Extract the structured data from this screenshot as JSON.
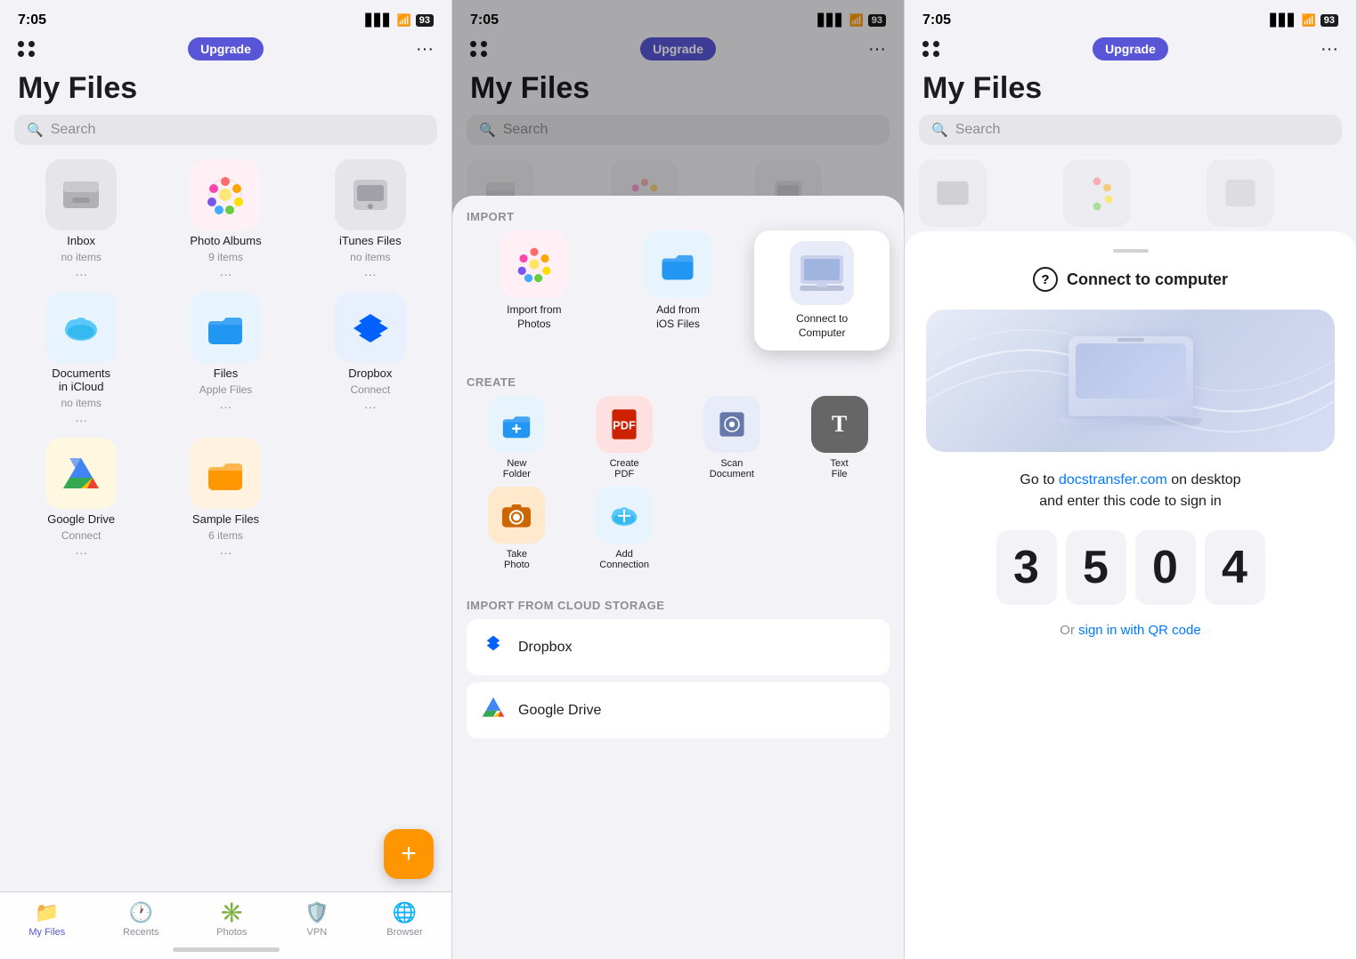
{
  "panel1": {
    "status_time": "7:05",
    "battery": "93",
    "title": "My Files",
    "search_placeholder": "Search",
    "upgrade_label": "Upgrade",
    "files": [
      {
        "name": "Inbox",
        "sub": "no items",
        "emoji": "📥",
        "bg": "#e5e5ea"
      },
      {
        "name": "Photo Albums",
        "sub": "9 items",
        "emoji": "🌸",
        "bg": "#fff0f5"
      },
      {
        "name": "iTunes Files",
        "sub": "no items",
        "emoji": "💾",
        "bg": "#e5e5ea"
      },
      {
        "name": "Documents in iCloud",
        "sub": "no items",
        "emoji": "☁️",
        "bg": "#e8f4fd"
      },
      {
        "name": "Files",
        "sub": "Apple Files",
        "emoji": "📁",
        "bg": "#e8f4fd"
      },
      {
        "name": "Dropbox",
        "sub": "Connect",
        "emoji": "📦",
        "bg": "#e8f0fe"
      },
      {
        "name": "Google Drive",
        "sub": "Connect",
        "emoji": "🔺",
        "bg": "#fff8e1"
      },
      {
        "name": "Sample Files",
        "sub": "6 items",
        "emoji": "📂",
        "bg": "#fff3e0"
      }
    ],
    "nav": [
      {
        "label": "My Files",
        "icon": "📁",
        "active": true
      },
      {
        "label": "Recents",
        "icon": "🕐",
        "active": false
      },
      {
        "label": "Photos",
        "icon": "✳️",
        "active": false
      },
      {
        "label": "VPN",
        "icon": "🛡️",
        "active": false
      },
      {
        "label": "Browser",
        "icon": "🌐",
        "active": false
      }
    ]
  },
  "panel2": {
    "status_time": "7:05",
    "battery": "93",
    "title": "My Files",
    "search_placeholder": "Search",
    "upgrade_label": "Upgrade",
    "import_label": "IMPORT",
    "create_label": "CREATE",
    "cloud_label": "IMPORT FROM CLOUD STORAGE",
    "import_actions": [
      {
        "name": "Import from Photos",
        "emoji": "🌸",
        "bg": "#fff0f5"
      },
      {
        "name": "Add from iOS Files",
        "emoji": "📁",
        "bg": "#e8f4fd"
      }
    ],
    "connect_action": {
      "name": "Connect to Computer",
      "emoji": "💻",
      "bg": "#e8ecf8"
    },
    "create_actions": [
      {
        "name": "New Folder",
        "emoji": "📁",
        "bg": "#e8f4fd"
      },
      {
        "name": "Create PDF",
        "emoji": "📄",
        "bg": "#ffe0e0"
      },
      {
        "name": "Scan Document",
        "emoji": "📷",
        "bg": "#e8ecf8"
      },
      {
        "name": "Text File",
        "emoji": "T",
        "bg": "#555555"
      }
    ],
    "create_actions2": [
      {
        "name": "Take Photo",
        "emoji": "📸",
        "bg": "#ffe8cc"
      },
      {
        "name": "Add Connection",
        "emoji": "☁️",
        "bg": "#e8f4fd"
      }
    ],
    "cloud_actions": [
      {
        "name": "Dropbox",
        "emoji": "📦"
      },
      {
        "name": "Google Drive",
        "emoji": "🔺"
      }
    ]
  },
  "panel3": {
    "status_time": "7:05",
    "battery": "93",
    "title": "My Files",
    "search_placeholder": "Search",
    "upgrade_label": "Upgrade",
    "sheet_title": "Connect to computer",
    "desc_text": "Go to ",
    "desc_link": "docstransfer.com",
    "desc_rest": " on desktop\nand enter this code to sign in",
    "code": [
      "3",
      "5",
      "0",
      "4"
    ],
    "or_text": "Or ",
    "qr_link": "sign in with QR code"
  }
}
